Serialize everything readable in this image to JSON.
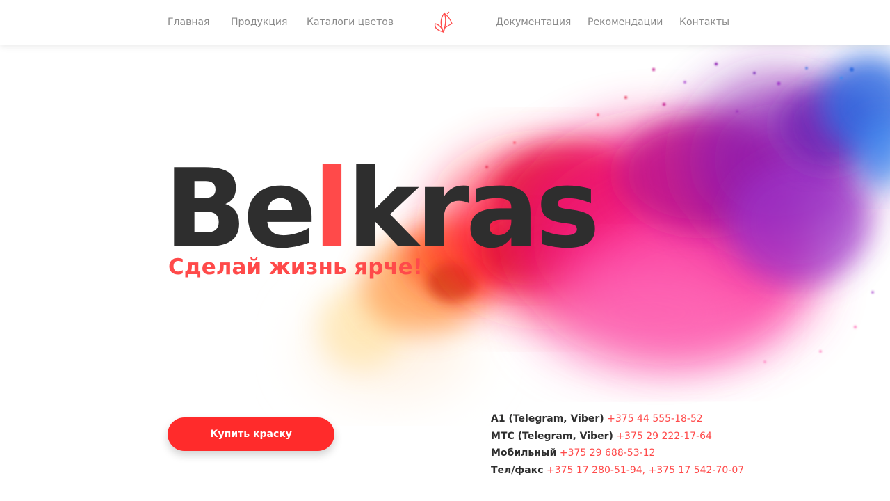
{
  "nav": {
    "items_left": [
      "Главная",
      "Продукция",
      "Каталоги цветов"
    ],
    "items_right": [
      "Документация",
      "Рекомендации",
      "Контакты"
    ],
    "logo_icon": "butterfly-icon"
  },
  "hero": {
    "brand_prefix": "Be",
    "brand_accent": "l",
    "brand_suffix": "kras",
    "tagline": "Сделай жизнь ярче!",
    "cta_label": "Купить краску"
  },
  "contacts": [
    {
      "label": "А1 (Telegram, Viber)",
      "value": "+375 44 555-18-52"
    },
    {
      "label": "МТС (Telegram, Viber)",
      "value": "+375 29 222-17-64"
    },
    {
      "label": "Мобильный",
      "value": "+375 29 688-53-12"
    },
    {
      "label": "Тел/факс",
      "value": "+375 17 280-51-94, +375 17 542-70-07"
    }
  ],
  "colors": {
    "accent": "#ff4a4a",
    "button": "#ff2b2b",
    "text_dark": "#2e2e2e",
    "nav_text": "#8a8a8a"
  }
}
